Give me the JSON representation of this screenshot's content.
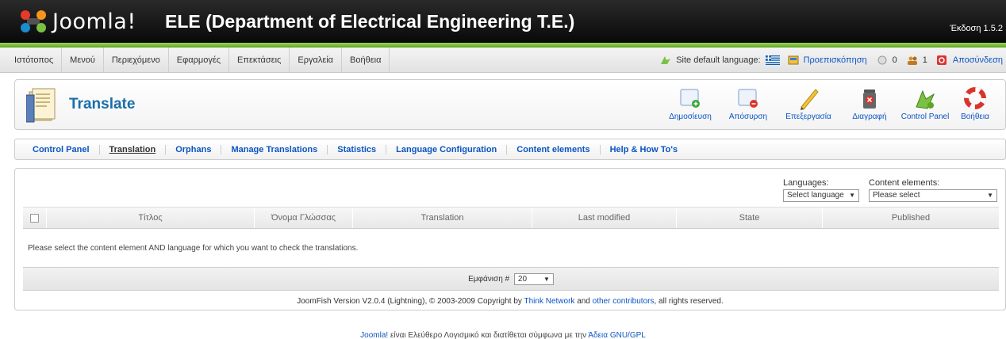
{
  "header": {
    "logo_text": "Joomla!",
    "site_title": "ELE (Department of Electrical Engineering T.E.)",
    "version": "Έκδοση 1.5.2"
  },
  "menu": [
    "Ιστότοπος",
    "Μενού",
    "Περιεχόμενο",
    "Εφαρμογές",
    "Επεκτάσεις",
    "Εργαλεία",
    "Βοήθεια"
  ],
  "status": {
    "site_language_label": "Site default language:",
    "preview": "Προεπισκόπηση",
    "messages_count": "0",
    "users_count": "1",
    "logout": "Αποσύνδεση"
  },
  "toolbar": {
    "title": "Translate",
    "buttons": [
      "Δημοσίευση",
      "Απόσυρση",
      "Επεξεργασία",
      "Διαγραφή",
      "Control Panel",
      "Βοήθεια"
    ]
  },
  "tabs": [
    "Control Panel",
    "Translation",
    "Orphans",
    "Manage Translations",
    "Statistics",
    "Language Configuration",
    "Content elements",
    "Help & How To's"
  ],
  "active_tab": "Translation",
  "filters": {
    "languages_label": "Languages:",
    "languages_value": "Select language",
    "content_label": "Content elements:",
    "content_value": "Please select"
  },
  "table": {
    "columns": [
      "Τίτλος",
      "Όνομα Γλώσσας",
      "Translation",
      "Last modified",
      "State",
      "Published"
    ],
    "empty_message": "Please select the content element AND language for which you want to check the translations."
  },
  "pagination": {
    "display_label": "Εμφάνιση #",
    "display_value": "20"
  },
  "credits": {
    "prefix": "JoomFish Version V2.0.4 (Lightning), © 2003-2009 Copyright by",
    "link1": "Think Network",
    "mid": "and",
    "link2": "other contributors",
    "suffix": ", all rights reserved."
  },
  "footer": {
    "joomla": "Joomla!",
    "text": "είναι Ελεύθερο Λογισμικό και διατίθεται σύμφωνα με την",
    "license": "Άδεια GNU/GPL"
  },
  "colors": {
    "accent": "#0b55c4",
    "title": "#1a6ea8",
    "green_bar": "#7cbd3a"
  }
}
